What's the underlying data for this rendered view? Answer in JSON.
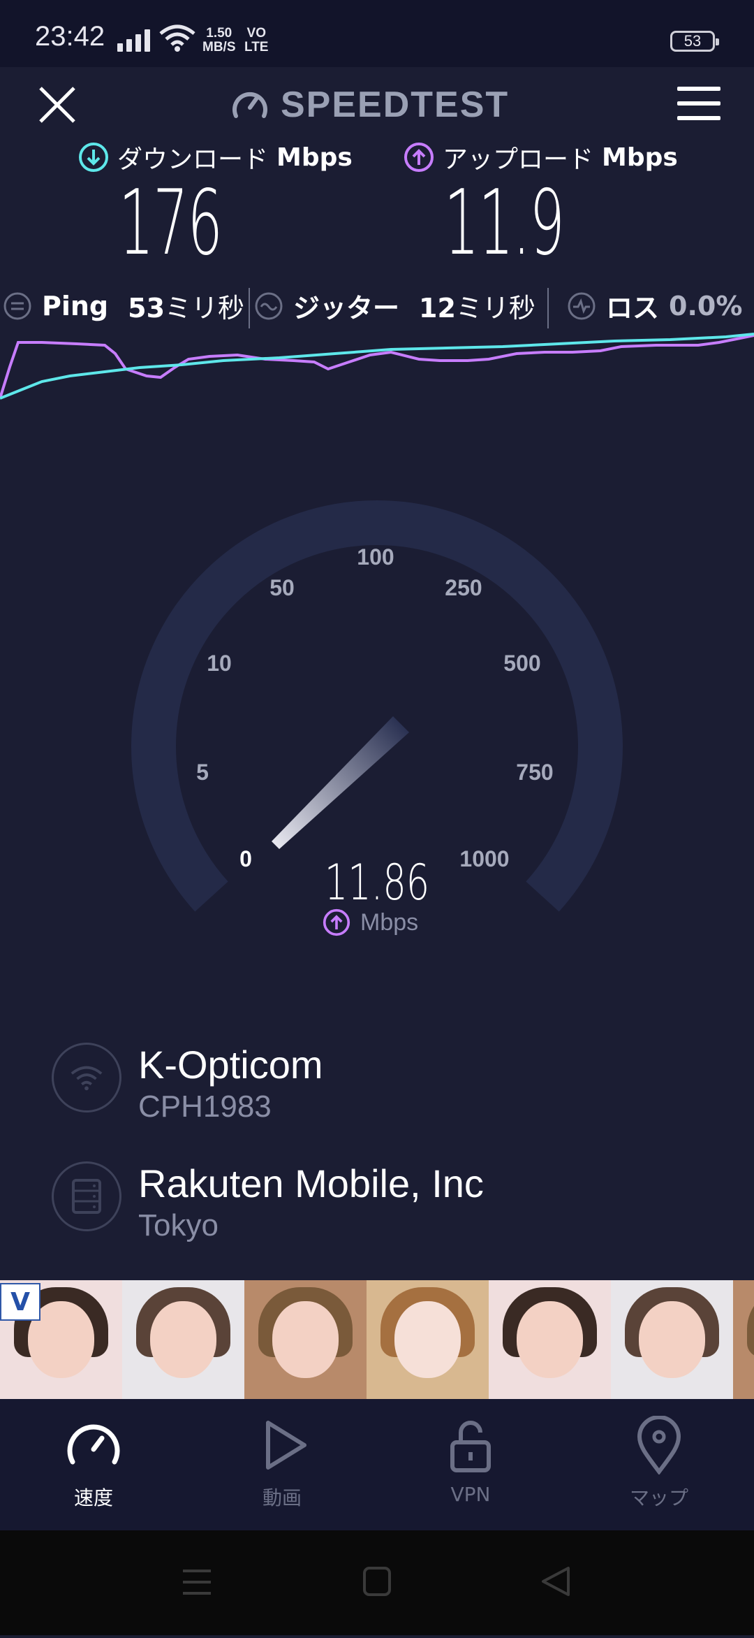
{
  "status_bar": {
    "time": "23:42",
    "net_speed_value": "1.50",
    "net_speed_unit": "MB/S",
    "volte_top": "VO",
    "volte_bottom": "LTE",
    "battery": "53"
  },
  "header": {
    "brand": "SPEEDTEST"
  },
  "download": {
    "label": "ダウンロード",
    "unit": "Mbps",
    "value": "176",
    "color": "#5ee7ea"
  },
  "upload": {
    "label": "アップロード",
    "unit": "Mbps",
    "value": "11.9",
    "color": "#c77dff"
  },
  "stats": {
    "ping_label": "Ping",
    "ping_value": "53",
    "ping_unit": "ミリ秒",
    "jitter_label": "ジッター",
    "jitter_value": "12",
    "jitter_unit": "ミリ秒",
    "loss_label": "ロス",
    "loss_value": "0.0%"
  },
  "gauge": {
    "ticks": [
      "0",
      "5",
      "10",
      "50",
      "100",
      "250",
      "500",
      "750",
      "1000"
    ],
    "current_value": "11.86",
    "unit": "Mbps"
  },
  "provider": {
    "name": "K-Opticom",
    "device": "CPH1983"
  },
  "server": {
    "name": "Rakuten Mobile, Inc",
    "location": "Tokyo"
  },
  "ad": {
    "logo_text": "V"
  },
  "nav": {
    "items": [
      {
        "label": "速度",
        "icon": "speedometer-icon",
        "active": true
      },
      {
        "label": "動画",
        "icon": "play-icon",
        "active": false
      },
      {
        "label": "VPN",
        "icon": "unlock-icon",
        "active": false
      },
      {
        "label": "マップ",
        "icon": "map-pin-icon",
        "active": false
      }
    ]
  }
}
